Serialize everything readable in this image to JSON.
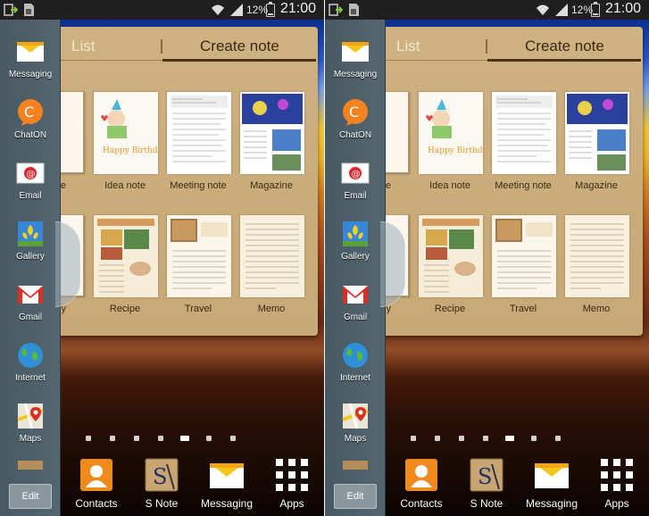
{
  "status_bar": {
    "battery_percent": "12%",
    "time": "21:00"
  },
  "note_panel": {
    "tab_list": "List",
    "tab_create": "Create note",
    "templates": [
      {
        "label": "Idea note"
      },
      {
        "label": "Meeting note"
      },
      {
        "label": "Magazine"
      },
      {
        "label": "Recipe"
      },
      {
        "label": "Travel"
      },
      {
        "label": "Memo"
      }
    ],
    "partial_labels": [
      "e",
      "y"
    ]
  },
  "sidebar": {
    "apps": [
      {
        "label": "Messaging",
        "icon": "envelope-icon"
      },
      {
        "label": "ChatON",
        "icon": "chaton-icon"
      },
      {
        "label": "Email",
        "icon": "email-icon"
      },
      {
        "label": "Gallery",
        "icon": "gallery-icon"
      },
      {
        "label": "Gmail",
        "icon": "gmail-icon"
      },
      {
        "label": "Internet",
        "icon": "globe-icon"
      },
      {
        "label": "Maps",
        "icon": "map-icon"
      }
    ],
    "edit_label": "Edit"
  },
  "home_pages": {
    "count": 7,
    "active_index": 4
  },
  "dock": [
    {
      "label": "Contacts",
      "icon": "contacts-icon"
    },
    {
      "label": "S Note",
      "icon": "snote-icon"
    },
    {
      "label": "Messaging",
      "icon": "envelope-icon"
    },
    {
      "label": "Apps",
      "icon": "apps-grid-icon"
    }
  ]
}
